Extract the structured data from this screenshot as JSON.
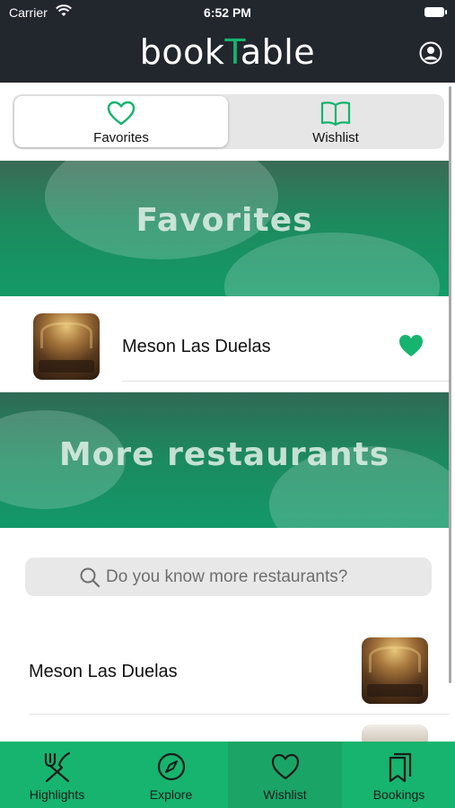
{
  "status_bar": {
    "carrier": "Carrier",
    "time": "6:52 PM"
  },
  "header": {
    "logo_prefix": "book",
    "logo_t": "T",
    "logo_suffix": "able",
    "accent_color": "#16b46e"
  },
  "segment": {
    "tabs": [
      {
        "label": "Favorites",
        "icon": "heart-outline-icon",
        "selected": true
      },
      {
        "label": "Wishlist",
        "icon": "book-icon",
        "selected": false
      }
    ]
  },
  "favorites": {
    "banner_title": "Favorites",
    "items": [
      {
        "name": "Meson Las Duelas",
        "favorited": true
      }
    ]
  },
  "more": {
    "banner_title": "More restaurants",
    "search_placeholder": "Do you know more restaurants?",
    "items": [
      {
        "name": "Meson Las Duelas"
      }
    ]
  },
  "tabbar": {
    "items": [
      {
        "label": "Highlights",
        "icon": "fork-knife-icon"
      },
      {
        "label": "Explore",
        "icon": "compass-icon"
      },
      {
        "label": "Wishlist",
        "icon": "heart-outline-icon",
        "selected": true
      },
      {
        "label": "Bookings",
        "icon": "bookmarks-icon"
      }
    ]
  }
}
